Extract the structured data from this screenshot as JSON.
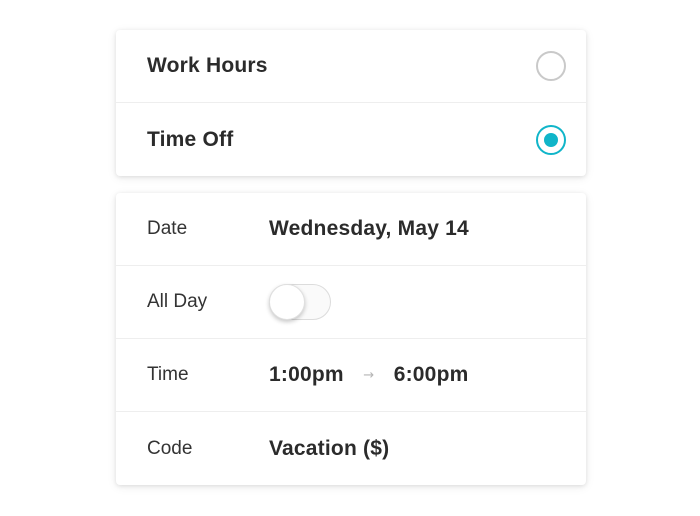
{
  "options": [
    {
      "label": "Work Hours",
      "selected": false
    },
    {
      "label": "Time Off",
      "selected": true
    }
  ],
  "colors": {
    "accent": "#10b5c9",
    "radio_border": "#c9c9c9",
    "text": "#2b2b2b"
  },
  "form": {
    "date": {
      "label": "Date",
      "value": "Wednesday, May 14"
    },
    "all_day": {
      "label": "All Day",
      "on": false
    },
    "time": {
      "label": "Time",
      "start": "1:00pm",
      "arrow_icon": "arrow-right-icon",
      "arrow_glyph": "→",
      "end": "6:00pm"
    },
    "code": {
      "label": "Code",
      "value": "Vacation ($)"
    }
  }
}
